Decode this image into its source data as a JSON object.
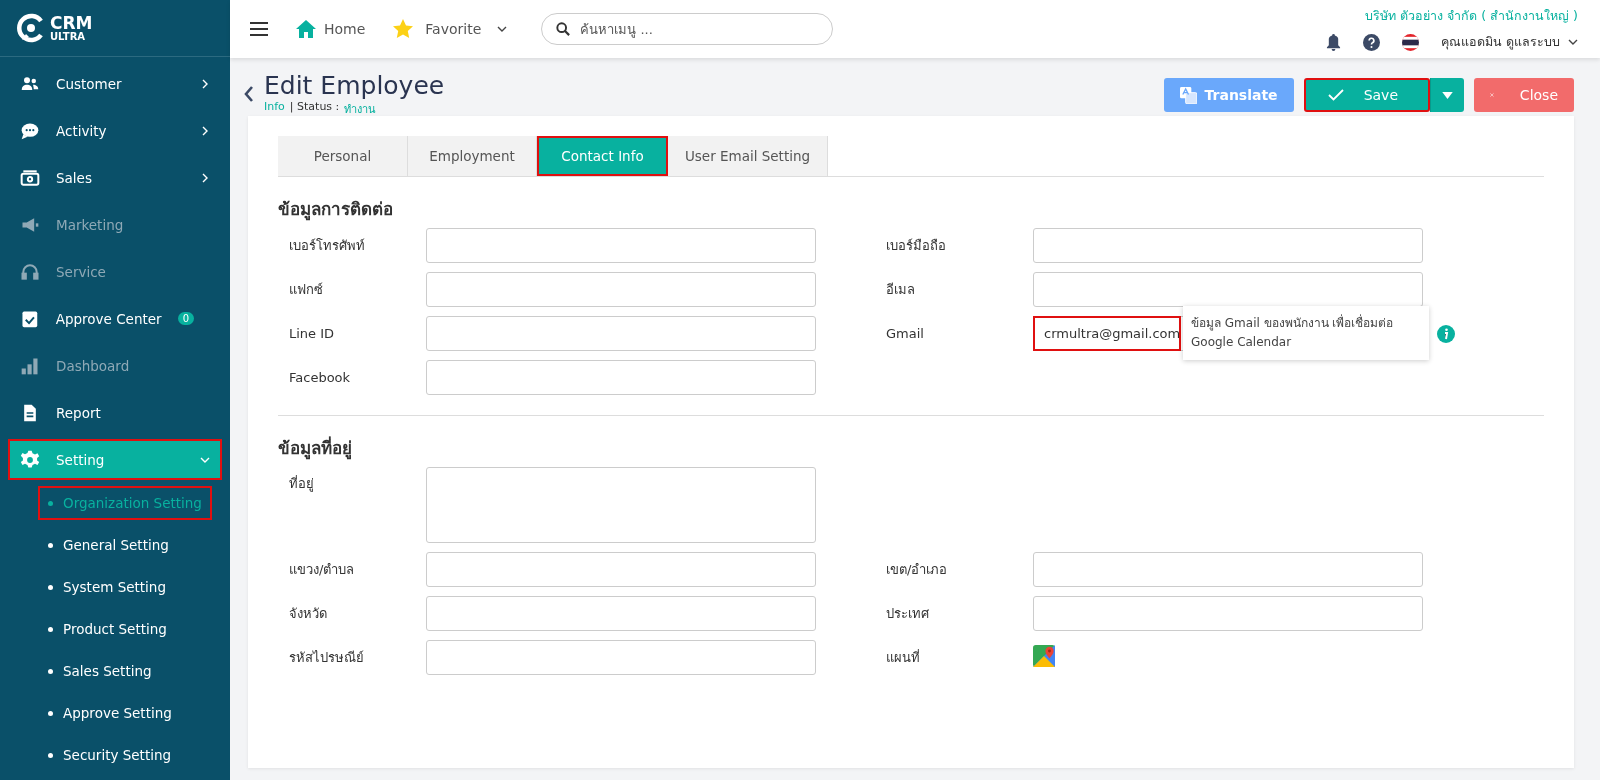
{
  "sidebar": {
    "logo": {
      "line_1": "CRM",
      "line_2": "ULTRA"
    },
    "items": [
      {
        "label": "Customer",
        "expanded": false,
        "disabled": false,
        "selected": false,
        "highlighted": false
      },
      {
        "label": "Activity",
        "expanded": false,
        "disabled": false,
        "selected": false,
        "highlighted": false
      },
      {
        "label": "Sales",
        "expanded": false,
        "disabled": false,
        "selected": false,
        "highlighted": false
      },
      {
        "label": "Marketing",
        "disabled": true,
        "selected": false,
        "highlighted": false
      },
      {
        "label": "Service",
        "disabled": true,
        "selected": false,
        "highlighted": false
      },
      {
        "label": "Approve Center",
        "disabled": false,
        "selected": false,
        "highlighted": false,
        "badge": "0"
      },
      {
        "label": "Dashboard",
        "disabled": true,
        "selected": false,
        "highlighted": false
      },
      {
        "label": "Report",
        "disabled": false,
        "selected": false,
        "highlighted": false
      },
      {
        "label": "Setting",
        "expanded": true,
        "disabled": false,
        "selected": true,
        "highlighted": true,
        "children": [
          {
            "label": "Organization Setting",
            "selected": true,
            "highlighted": true
          },
          {
            "label": "General Setting",
            "selected": false,
            "highlighted": false
          },
          {
            "label": "System Setting",
            "selected": false,
            "highlighted": false
          },
          {
            "label": "Product Setting",
            "selected": false,
            "highlighted": false
          },
          {
            "label": "Sales Setting",
            "selected": false,
            "highlighted": false
          },
          {
            "label": "Approve Setting",
            "selected": false,
            "highlighted": false
          },
          {
            "label": "Security Setting",
            "selected": false,
            "highlighted": false
          }
        ]
      }
    ]
  },
  "header": {
    "home": "Home",
    "favorite": "Favorite",
    "search": {
      "placeholder": "ค้นหาเมนู ..."
    },
    "company": "บริษัท ตัวอย่าง จำกัด ( สำนักงานใหญ่ )",
    "user": "คุณแอดมิน ดูแลระบบ"
  },
  "page": {
    "title": "Edit Employee",
    "subtitle_link": "Info",
    "status_label": "| Status :",
    "status_value": "ทำงาน",
    "buttons": [
      {
        "label": "Translate",
        "kind": "translate",
        "highlighted": false
      },
      {
        "label": "Save",
        "kind": "save",
        "highlighted": true
      },
      {
        "label": "Close",
        "kind": "close",
        "highlighted": false
      }
    ]
  },
  "tabs": [
    {
      "label": "Personal",
      "selected": false,
      "highlighted": false
    },
    {
      "label": "Employment",
      "selected": false,
      "highlighted": false
    },
    {
      "label": "Contact Info",
      "selected": true,
      "highlighted": true
    },
    {
      "label": "User Email Setting",
      "selected": false,
      "highlighted": false
    }
  ],
  "sections": [
    {
      "title": "ข้อมูลการติดต่อ",
      "rows": [
        {
          "left": {
            "label": "เบอร์โทรศัพท์",
            "kind": "text"
          },
          "right": {
            "label": "เบอร์มือถือ",
            "kind": "text"
          }
        },
        {
          "left": {
            "label": "แฟกซ์",
            "kind": "text"
          },
          "right": {
            "label": "อีเมล",
            "kind": "text"
          }
        },
        {
          "left": {
            "label": "Line ID",
            "kind": "text"
          },
          "right": {
            "label": "Gmail",
            "kind": "text",
            "value": "crmultra@gmail.com",
            "highlighted": true,
            "tooltip": "ข้อมูล Gmail ของพนักงาน เพื่อเชื่อมต่อ Google Calendar"
          }
        },
        {
          "left": {
            "label": "Facebook",
            "kind": "text"
          }
        }
      ]
    },
    {
      "title": "ข้อมูลที่อยู่",
      "rows": [
        {
          "left": {
            "label": "ที่อยู่",
            "kind": "textarea"
          }
        },
        {
          "left": {
            "label": "แขวง/ตำบล",
            "kind": "text"
          },
          "right": {
            "label": "เขต/อำเภอ",
            "kind": "text"
          }
        },
        {
          "left": {
            "label": "จังหวัด",
            "kind": "text"
          },
          "right": {
            "label": "ประเทศ",
            "kind": "text"
          }
        },
        {
          "left": {
            "label": "รหัสไปรษณีย์",
            "kind": "text"
          },
          "right": {
            "label": "แผนที่",
            "kind": "map"
          }
        }
      ]
    }
  ]
}
